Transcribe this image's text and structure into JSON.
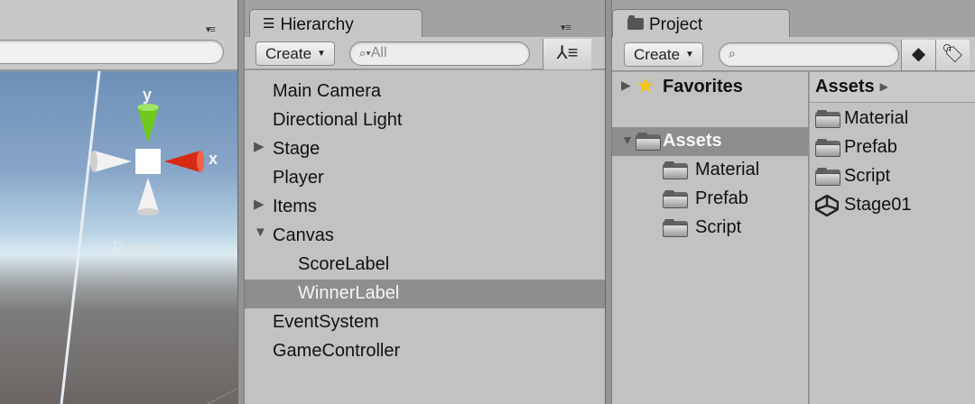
{
  "scene": {
    "axis_y_label": "y",
    "axis_x_label": "x",
    "projection_label": "‹Persp"
  },
  "hierarchy": {
    "tab_title": "Hierarchy",
    "tab_icon": "list-icon",
    "create_label": "Create",
    "search_placeholder": "All",
    "items": [
      {
        "label": "Main Camera",
        "expand": "",
        "depth": 0,
        "selected": false
      },
      {
        "label": "Directional Light",
        "expand": "",
        "depth": 0,
        "selected": false
      },
      {
        "label": "Stage",
        "expand": "collapsed",
        "depth": 0,
        "selected": false
      },
      {
        "label": "Player",
        "expand": "",
        "depth": 0,
        "selected": false
      },
      {
        "label": "Items",
        "expand": "collapsed",
        "depth": 0,
        "selected": false
      },
      {
        "label": "Canvas",
        "expand": "expanded",
        "depth": 0,
        "selected": false
      },
      {
        "label": "ScoreLabel",
        "expand": "",
        "depth": 1,
        "selected": false
      },
      {
        "label": "WinnerLabel",
        "expand": "",
        "depth": 1,
        "selected": true
      },
      {
        "label": "EventSystem",
        "expand": "",
        "depth": 0,
        "selected": false
      },
      {
        "label": "GameController",
        "expand": "",
        "depth": 0,
        "selected": false
      }
    ]
  },
  "project": {
    "tab_title": "Project",
    "tab_icon": "folder-icon",
    "create_label": "Create",
    "favorites_label": "Favorites",
    "assets_root_label": "Assets",
    "tree_children": [
      "Material",
      "Prefab",
      "Script"
    ],
    "assets_header": "Assets",
    "assets_items": [
      {
        "label": "Material",
        "icon": "folder-icon"
      },
      {
        "label": "Prefab",
        "icon": "folder-icon"
      },
      {
        "label": "Script",
        "icon": "folder-icon"
      },
      {
        "label": "Stage01",
        "icon": "unity-scene-icon"
      }
    ]
  },
  "colors": {
    "selection": "#8e8e8e",
    "axis_x": "#d62a12",
    "axis_y": "#6fc81e",
    "panel_bg": "#c2c2c2"
  }
}
